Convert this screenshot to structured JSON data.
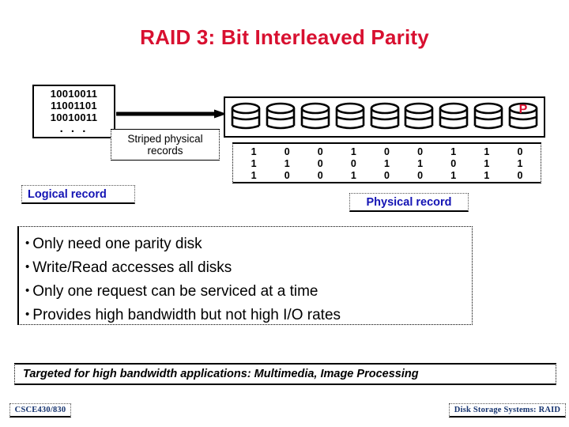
{
  "slide": {
    "title": "RAID 3: Bit Interleaved Parity"
  },
  "logical": {
    "bit_rows": [
      "10010011",
      "11001101",
      "10010011"
    ],
    "ellipsis": ". . .",
    "caption": "Logical record",
    "caption_color": "#1414b4"
  },
  "striping": {
    "arrow_label": "striped-arrow",
    "label": "Striped physical records"
  },
  "disk_array": {
    "disk_count": 9,
    "parity_disk_index": 8,
    "parity_label": "P",
    "parity_color": "#d81030",
    "disks": [
      {
        "name": "disk-1",
        "label": ""
      },
      {
        "name": "disk-2",
        "label": ""
      },
      {
        "name": "disk-3",
        "label": ""
      },
      {
        "name": "disk-4",
        "label": ""
      },
      {
        "name": "disk-5",
        "label": ""
      },
      {
        "name": "disk-6",
        "label": ""
      },
      {
        "name": "disk-7",
        "label": ""
      },
      {
        "name": "disk-8",
        "label": ""
      },
      {
        "name": "disk-parity",
        "label": "P"
      }
    ]
  },
  "bit_matrix": {
    "rows": [
      [
        "1",
        "0",
        "0",
        "1",
        "0",
        "0",
        "1",
        "1",
        "0"
      ],
      [
        "1",
        "1",
        "0",
        "0",
        "1",
        "1",
        "0",
        "1",
        "1"
      ],
      [
        "1",
        "0",
        "0",
        "1",
        "0",
        "0",
        "1",
        "1",
        "0"
      ]
    ],
    "caption": "Physical record",
    "caption_color": "#1414b4"
  },
  "bullets": {
    "marker": "•",
    "items": [
      "Only need one parity disk",
      "Write/Read accesses all disks",
      "Only one request can be serviced at a time",
      "Provides high bandwidth but not high I/O rates"
    ]
  },
  "banner": {
    "text": "Targeted for high bandwidth applications: Multimedia, Image Processing"
  },
  "footer": {
    "left": "CSCE430/830",
    "right": "Disk Storage Systems: RAID",
    "color": "#14326e"
  },
  "colors": {
    "title": "#d81030",
    "accent_blue": "#1414b4",
    "outline": "#000000"
  }
}
